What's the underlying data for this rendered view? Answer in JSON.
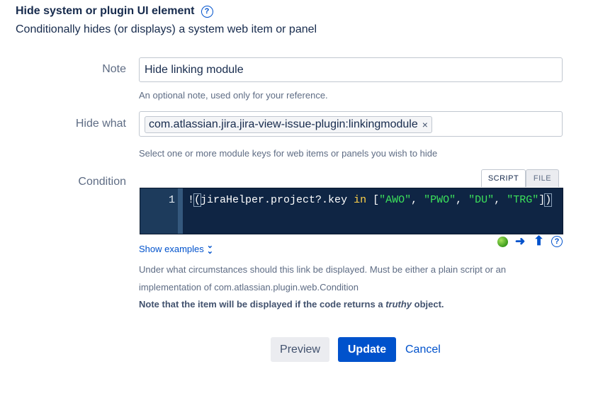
{
  "header": {
    "title": "Hide system or plugin UI element",
    "subtitle": "Conditionally hides (or displays) a system web item or panel",
    "help_glyph": "?"
  },
  "note": {
    "label": "Note",
    "value": "Hide linking module",
    "hint": "An optional note, used only for your reference."
  },
  "hide_what": {
    "label": "Hide what",
    "tags": [
      "com.atlassian.jira.jira-view-issue-plugin:linkingmodule"
    ],
    "remove_glyph": "×",
    "hint": "Select one or more module keys for web items or panels you wish to hide"
  },
  "condition": {
    "label": "Condition",
    "tabs": [
      {
        "label": "SCRIPT",
        "active": true
      },
      {
        "label": "FILE",
        "active": false
      }
    ],
    "line_number": "1",
    "code": {
      "not": "!",
      "open_paren": "(",
      "expr": "jiraHelper.project?.key ",
      "keyword": "in",
      "list_open": " [",
      "strings": [
        "\"AWO\"",
        "\"PWO\"",
        "\"DU\"",
        "\"TRG\""
      ],
      "sep": ", ",
      "list_close": "]",
      "close_paren": ")"
    },
    "show_examples": "Show examples",
    "desc_line1": "Under what circumstances should this link be displayed. Must be either a plain script or an",
    "desc_line2": "implementation of com.atlassian.plugin.web.Condition",
    "note_prefix": "Note that the item will be displayed if the code returns a ",
    "note_em": "truthy",
    "note_suffix": " object."
  },
  "toolbar_icons": [
    "status-ok-icon",
    "arrow-right-icon",
    "arrow-up-icon",
    "help-icon"
  ],
  "buttons": {
    "preview": "Preview",
    "update": "Update",
    "cancel": "Cancel"
  }
}
